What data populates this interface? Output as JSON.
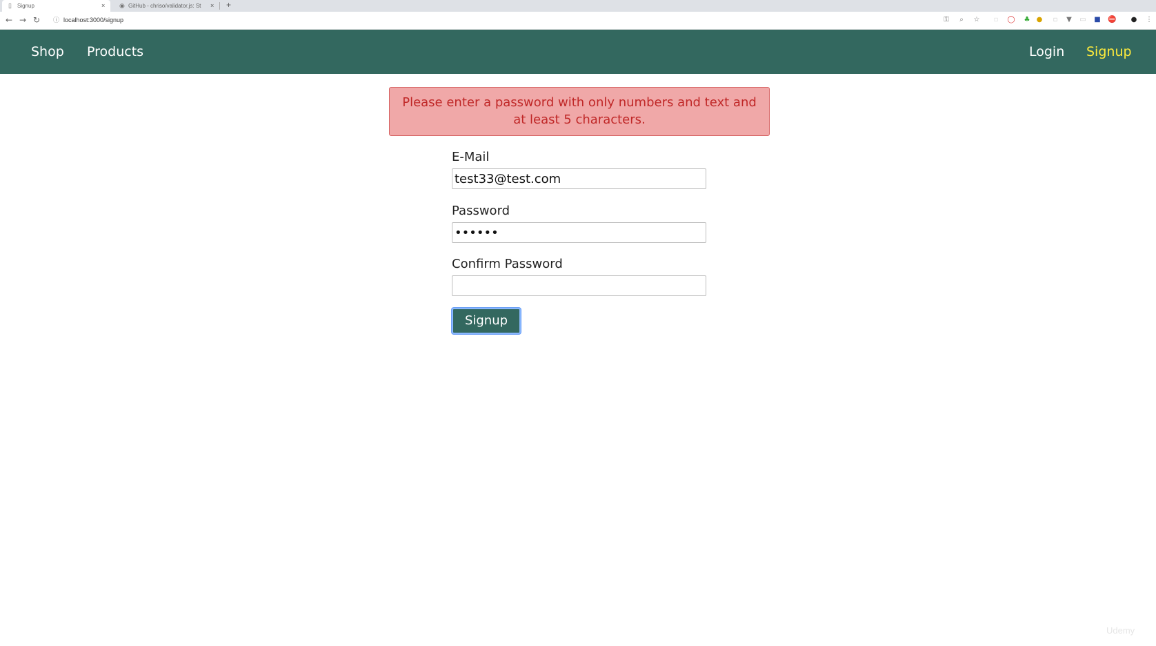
{
  "browser": {
    "tabs": [
      {
        "title": "Signup",
        "close_glyph": "×",
        "icon": "page-icon",
        "active": true
      },
      {
        "title": "GitHub - chriso/validator.js: St",
        "close_glyph": "×",
        "icon": "github-icon",
        "active": false
      }
    ],
    "new_tab_glyph": "+",
    "url": "localhost:3000/signup",
    "nav_glyphs": {
      "back": "←",
      "forward": "→",
      "reload": "↻",
      "info": "ⓘ"
    },
    "extension_icons": [
      "key-icon",
      "zoom-icon",
      "star-icon",
      "extension-icon",
      "opera-icon",
      "extension-icon",
      "extension-icon",
      "extension-icon",
      "filter-icon",
      "extension-icon",
      "extension-icon",
      "stop-icon",
      "profile-avatar-icon",
      "menu-icon"
    ]
  },
  "nav": {
    "shop": "Shop",
    "products": "Products",
    "login": "Login",
    "signup": "Signup",
    "active_item": "Signup",
    "active_color": "#ffeb3b",
    "background_color": "#33685f"
  },
  "alert": {
    "message": "Please enter a password with only numbers and text and at least 5 characters."
  },
  "form": {
    "email_label": "E-Mail",
    "email_value": "test33@test.com",
    "password_label": "Password",
    "password_value": "••••••",
    "confirm_label": "Confirm Password",
    "confirm_value": "",
    "submit_label": "Signup"
  },
  "watermark": "Udemy"
}
